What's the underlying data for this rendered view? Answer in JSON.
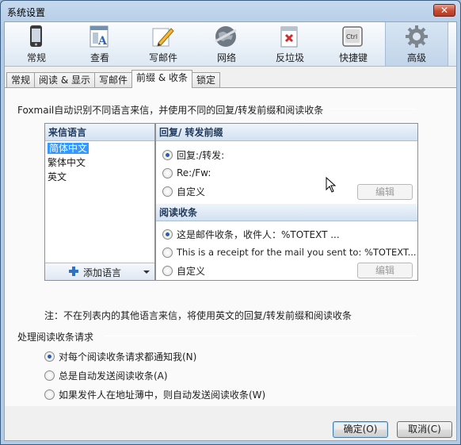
{
  "window": {
    "title": "系统设置",
    "close_label": "✕"
  },
  "toolbar": {
    "items": [
      {
        "label": "常规",
        "icon": "phone-icon"
      },
      {
        "label": "查看",
        "icon": "view-icon"
      },
      {
        "label": "写邮件",
        "icon": "pencil-icon"
      },
      {
        "label": "网络",
        "icon": "globe-icon"
      },
      {
        "label": "反垃圾",
        "icon": "spam-icon"
      },
      {
        "label": "快捷键",
        "icon": "keyboard-icon"
      },
      {
        "label": "高级",
        "icon": "gear-icon",
        "active": true
      }
    ]
  },
  "tabs": [
    "常规",
    "阅读 & 显示",
    "写邮件",
    "前缀 & 收条",
    "锁定"
  ],
  "active_tab": "前缀 & 收条",
  "section1": {
    "title": "Foxmail自动识别不同语言来信，并使用不同的回复/转发前缀和阅读收条",
    "lang_header": "来信语言",
    "languages": [
      "简体中文",
      "繁体中文",
      "英文"
    ],
    "selected_language": "简体中文",
    "add_language": "添加语言",
    "prefix_header": "回复/ 转发前缀",
    "prefix_options": [
      "回复:/转发:",
      "Re:/Fw:",
      "自定义"
    ],
    "prefix_selected": 0,
    "receipt_header": "阅读收条",
    "receipt_options": [
      "这是邮件收条，收件人：%TOTEXT ...",
      "This is a receipt for the mail you sent to: %TOTEXT...",
      "自定义"
    ],
    "receipt_selected": 0,
    "edit_label": "编辑",
    "note": "注：不在列表内的其他语言来信，将使用英文的回复/转发前缀和阅读收条"
  },
  "section2": {
    "title": "处理阅读收条请求",
    "options": [
      "对每个阅读收条请求都通知我(N)",
      "总是自动发送阅读收条(A)",
      "如果发件人在地址薄中，则自动发送阅读收条(W)"
    ],
    "selected": 0
  },
  "buttons": {
    "ok": "确定(O)",
    "cancel": "取消(C)"
  },
  "colors": {
    "accent": "#2a5fa8",
    "header_text": "#1e395b",
    "selection": "#3399ff"
  }
}
